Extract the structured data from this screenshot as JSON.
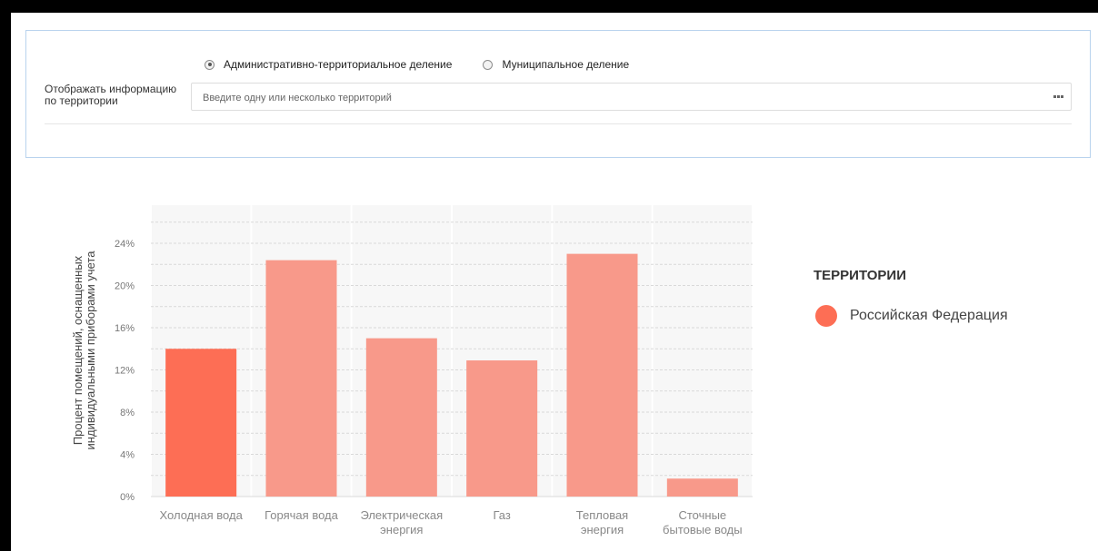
{
  "filter": {
    "radio_options": [
      {
        "label": "Административно-территориальное деление",
        "checked": true
      },
      {
        "label": "Муниципальное деление",
        "checked": false
      }
    ],
    "label": "Отображать информацию по территории",
    "input_placeholder": "Введите одну или несколько территорий",
    "input_value": ""
  },
  "colors": {
    "selected_bar": "#fd6e55",
    "bar": "#f8998a",
    "legend_dot": "#fd6e55",
    "panel_border": "#b9d3ee"
  },
  "legend": {
    "title": "ТЕРРИТОРИИ",
    "items": [
      {
        "label": "Российская Федерация"
      }
    ]
  },
  "chart_data": {
    "type": "bar",
    "categories": [
      [
        "Холодная вода"
      ],
      [
        "Горячая вода"
      ],
      [
        "Электрическая",
        "энергия"
      ],
      [
        "Газ"
      ],
      [
        "Тепловая",
        "энергия"
      ],
      [
        "Сточные",
        "бытовые воды"
      ]
    ],
    "series": [
      {
        "name": "Российская Федерация",
        "values": [
          14.0,
          22.4,
          15.0,
          12.9,
          23.0,
          1.7
        ]
      }
    ],
    "highlighted_index": 0,
    "ylabel": [
      "Процент помещений, оснащенных",
      "индивидуальными приборами учета"
    ],
    "yticks": [
      "0%",
      "4%",
      "8%",
      "12%",
      "16%",
      "20%",
      "24%"
    ],
    "ytick_values": [
      0,
      4,
      8,
      12,
      16,
      20,
      24
    ],
    "ylim": [
      0,
      24
    ],
    "grid": true,
    "legend_position": "right"
  }
}
